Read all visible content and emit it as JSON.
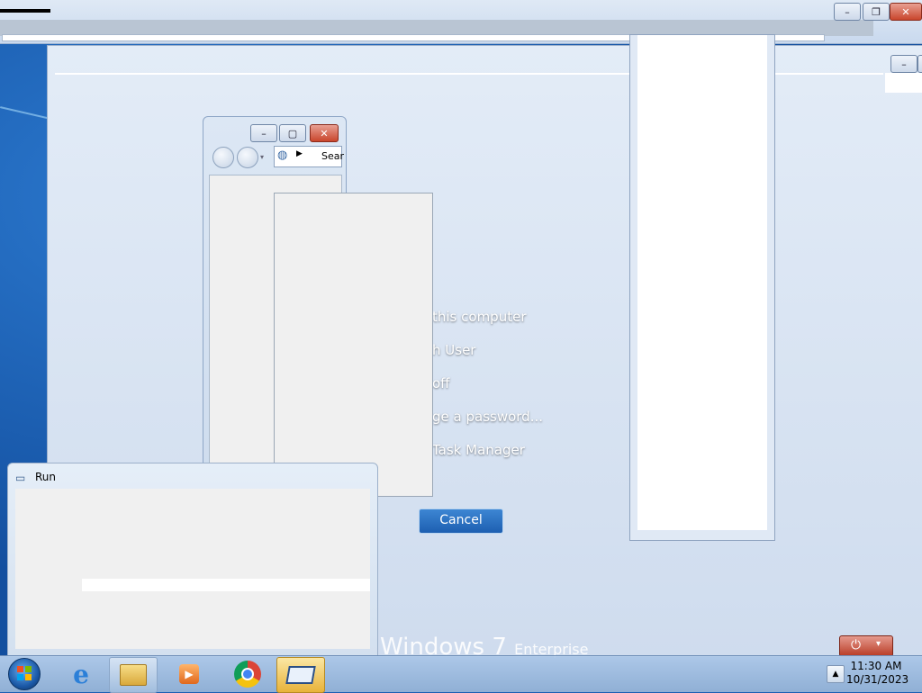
{
  "caption_buttons": {
    "minimize": "–",
    "restore": "❐",
    "maximize": "▢",
    "close": "✕"
  },
  "security_options": {
    "items": [
      "this computer",
      "h User",
      "off",
      "ge a password...",
      "Task Manager"
    ],
    "cancel": "Cancel"
  },
  "branding": {
    "windows": "Windows",
    "version": "7",
    "edition": "Enterprise"
  },
  "explorer": {
    "address_search": "Sear"
  },
  "run_dialog": {
    "title": "Run"
  },
  "taskbar": {
    "apps": [
      "Start",
      "Internet Explorer",
      "Windows Explorer",
      "Windows Media Player",
      "Google Chrome",
      "Run"
    ],
    "active_app": "Run",
    "clock_time": "11:30 AM",
    "clock_date": "10/31/2023"
  },
  "colors": {
    "accent": "#1d5fb1",
    "taskbar": "#a5bedd",
    "close": "#c9462c"
  }
}
